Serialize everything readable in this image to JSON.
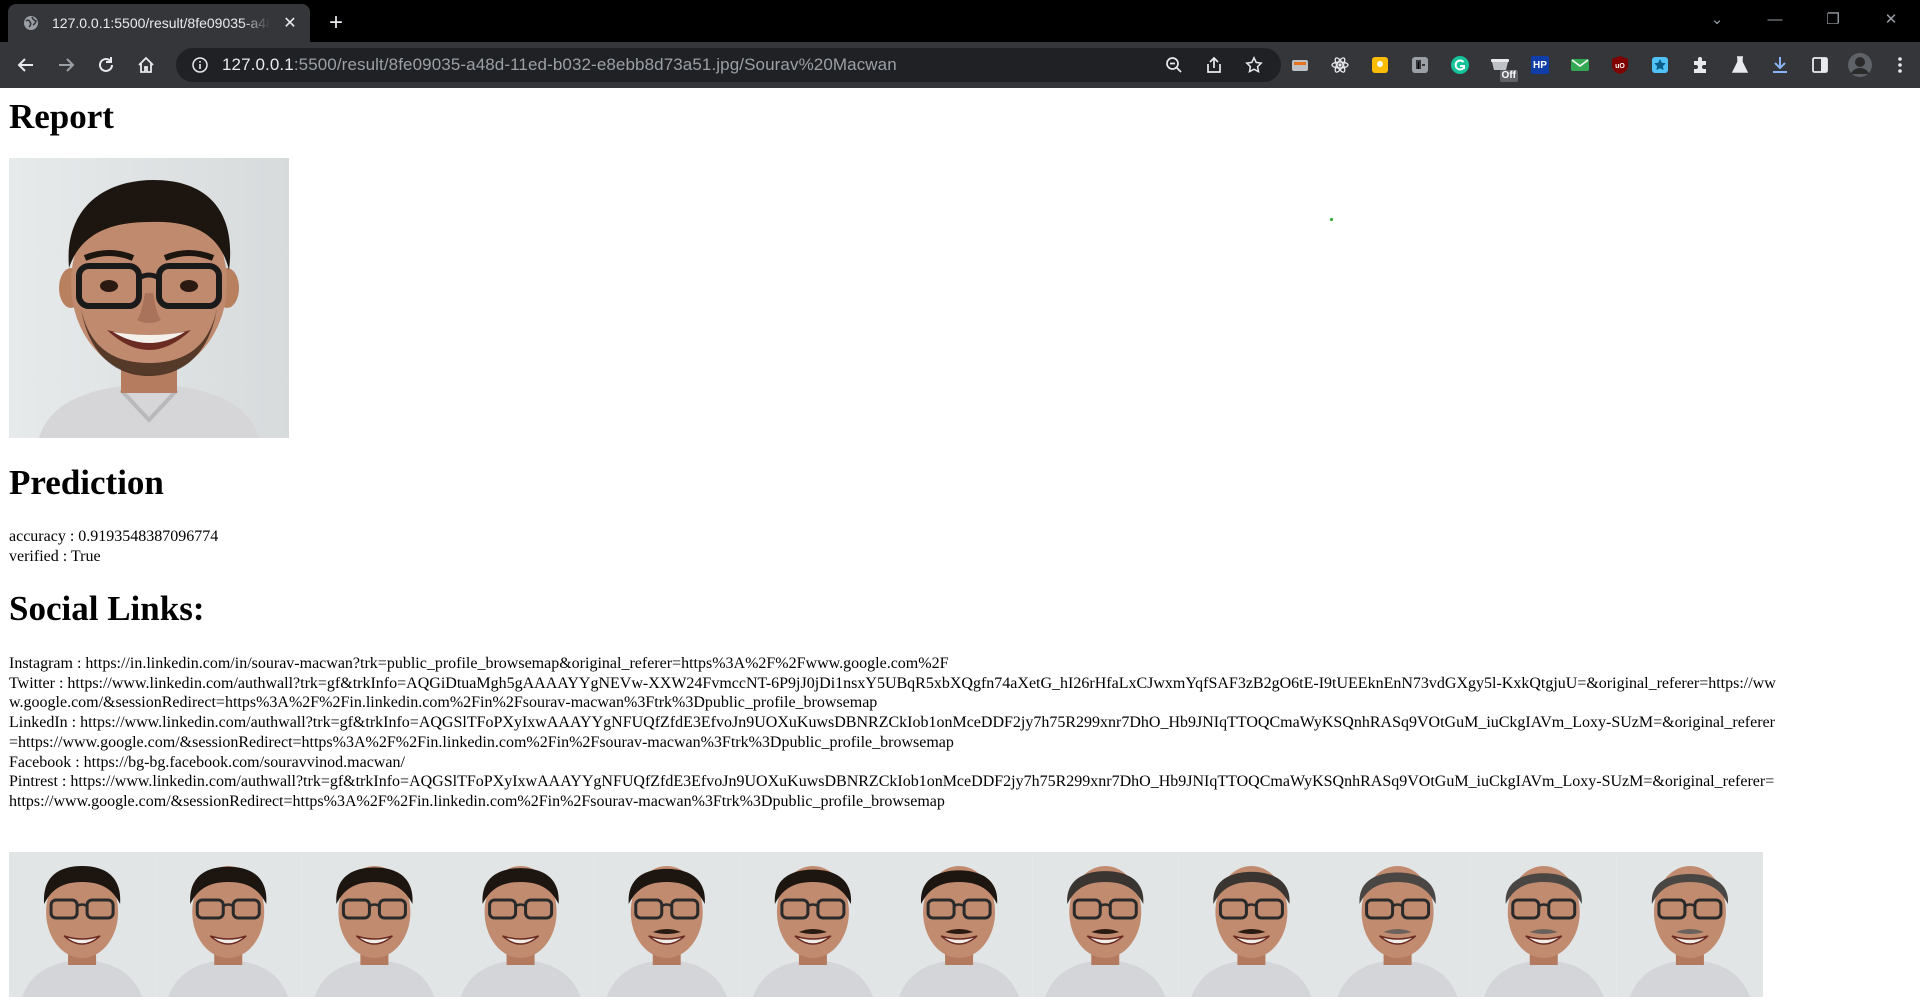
{
  "browser": {
    "tab_title": "127.0.0.1:5500/result/8fe09035-a48d-11ed-b032-e8ebb8d73a51.jpg/Sourav%20Macwan",
    "url_host": "127.0.0.1",
    "url_rest": ":5500/result/8fe09035-a48d-11ed-b032-e8ebb8d73a51.jpg/Sourav%20Macwan",
    "extension_badge": "Off",
    "hp_label": "HP"
  },
  "page": {
    "report_heading": "Report",
    "prediction_heading": "Prediction",
    "accuracy_label": "accuracy : 0.9193548387096774",
    "verified_label": "verified : True",
    "social_heading": "Social Links:",
    "social_links": [
      "Instagram : https://in.linkedin.com/in/sourav-macwan?trk=public_profile_browsemap&original_referer=https%3A%2F%2Fwww.google.com%2F",
      "Twitter : https://www.linkedin.com/authwall?trk=gf&trkInfo=AQGiDtuaMgh5gAAAAYYgNEVw-XXW24FvmccNT-6P9jJ0jDi1nsxY5UBqR5xbXQgfn74aXetG_hI26rHfaLxCJwxmYqfSAF3zB2gO6tE-I9tUEEknEnN73vdGXgy5l-KxkQtgjuU=&original_referer=https://www.google.com/&sessionRedirect=https%3A%2F%2Fin.linkedin.com%2Fin%2Fsourav-macwan%3Ftrk%3Dpublic_profile_browsemap",
      "LinkedIn : https://www.linkedin.com/authwall?trk=gf&trkInfo=AQGSlTFoPXyIxwAAAYYgNFUQfZfdE3EfvoJn9UOXuKuwsDBNRZCkIob1onMceDDF2jy7h75R299xnr7DhO_Hb9JNIqTTOQCmaWyKSQnhRASq9VOtGuM_iuCkgIAVm_Loxy-SUzM=&original_referer=https://www.google.com/&sessionRedirect=https%3A%2F%2Fin.linkedin.com%2Fin%2Fsourav-macwan%3Ftrk%3Dpublic_profile_browsemap",
      "Facebook : https://bg-bg.facebook.com/souravvinod.macwan/",
      "Pintrest : https://www.linkedin.com/authwall?trk=gf&trkInfo=AQGSlTFoPXyIxwAAAYYgNFUQfZfdE3EfvoJn9UOXuKuwsDBNRZCkIob1onMceDDF2jy7h75R299xnr7DhO_Hb9JNIqTTOQCmaWyKSQnhRASq9VOtGuM_iuCkgIAVm_Loxy-SUzM=&original_referer=https://www.google.com/&sessionRedirect=https%3A%2F%2Fin.linkedin.com%2Fin%2Fsourav-macwan%3Ftrk%3Dpublic_profile_browsemap"
    ],
    "aging_strip_frames": 12
  },
  "colors": {
    "tabbar_bg": "#000000",
    "toolbar_bg": "#35363a",
    "omnibox_bg": "#202124",
    "photo_bg": "#dfe3e4",
    "skin": "#c08a6e",
    "hair_dark": "#1d1510",
    "shirt": "#d6d6d8"
  }
}
